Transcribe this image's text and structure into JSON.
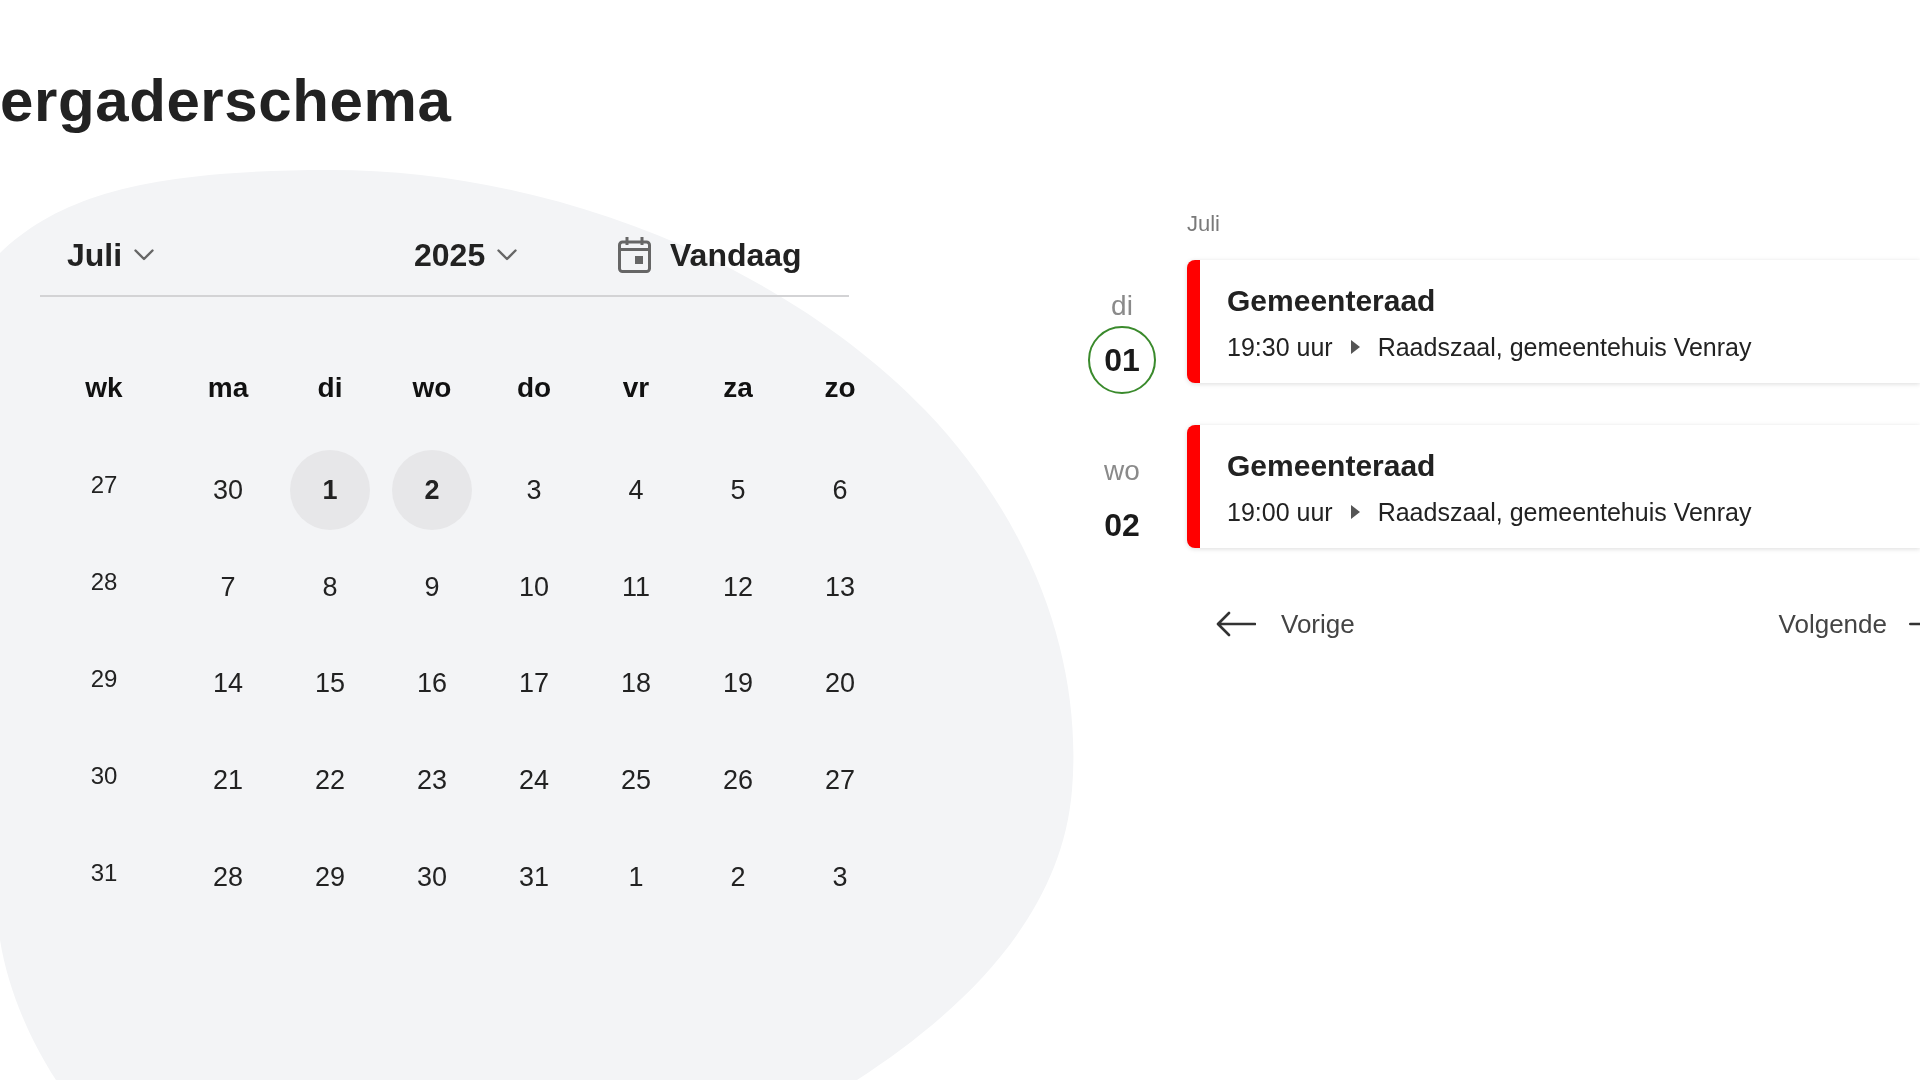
{
  "page": {
    "title": "ergaderschema"
  },
  "calendar": {
    "month_select": {
      "value": "Juli"
    },
    "year_select": {
      "value": "2025"
    },
    "today_button": {
      "label": "Vandaag"
    },
    "weekday_headers": [
      "wk",
      "ma",
      "di",
      "wo",
      "do",
      "vr",
      "za",
      "zo"
    ],
    "weeks": [
      {
        "week": "27",
        "days": [
          {
            "label": "30",
            "highlighted": false
          },
          {
            "label": "1",
            "highlighted": true
          },
          {
            "label": "2",
            "highlighted": true
          },
          {
            "label": "3",
            "highlighted": false
          },
          {
            "label": "4",
            "highlighted": false
          },
          {
            "label": "5",
            "highlighted": false
          },
          {
            "label": "6",
            "highlighted": false
          }
        ]
      },
      {
        "week": "28",
        "days": [
          {
            "label": "7",
            "highlighted": false
          },
          {
            "label": "8",
            "highlighted": false
          },
          {
            "label": "9",
            "highlighted": false
          },
          {
            "label": "10",
            "highlighted": false
          },
          {
            "label": "11",
            "highlighted": false
          },
          {
            "label": "12",
            "highlighted": false
          },
          {
            "label": "13",
            "highlighted": false
          }
        ]
      },
      {
        "week": "29",
        "days": [
          {
            "label": "14",
            "highlighted": false
          },
          {
            "label": "15",
            "highlighted": false
          },
          {
            "label": "16",
            "highlighted": false
          },
          {
            "label": "17",
            "highlighted": false
          },
          {
            "label": "18",
            "highlighted": false
          },
          {
            "label": "19",
            "highlighted": false
          },
          {
            "label": "20",
            "highlighted": false
          }
        ]
      },
      {
        "week": "30",
        "days": [
          {
            "label": "21",
            "highlighted": false
          },
          {
            "label": "22",
            "highlighted": false
          },
          {
            "label": "23",
            "highlighted": false
          },
          {
            "label": "24",
            "highlighted": false
          },
          {
            "label": "25",
            "highlighted": false
          },
          {
            "label": "26",
            "highlighted": false
          },
          {
            "label": "27",
            "highlighted": false
          }
        ]
      },
      {
        "week": "31",
        "days": [
          {
            "label": "28",
            "highlighted": false
          },
          {
            "label": "29",
            "highlighted": false
          },
          {
            "label": "30",
            "highlighted": false
          },
          {
            "label": "31",
            "highlighted": false
          },
          {
            "label": "1",
            "highlighted": false
          },
          {
            "label": "2",
            "highlighted": false
          },
          {
            "label": "3",
            "highlighted": false
          }
        ]
      }
    ]
  },
  "agenda": {
    "month_label": "Juli",
    "days": [
      {
        "weekday": "di",
        "date": "01",
        "today": true,
        "events": [
          {
            "title": "Gemeenteraad",
            "time": "19:30 uur",
            "location": "Raadszaal, gemeentehuis Venray"
          }
        ]
      },
      {
        "weekday": "wo",
        "date": "02",
        "today": false,
        "events": [
          {
            "title": "Gemeenteraad",
            "time": "19:00 uur",
            "location": "Raadszaal, gemeentehuis Venray"
          }
        ]
      }
    ],
    "pagination": {
      "previous": "Vorige",
      "next": "Volgende"
    }
  }
}
